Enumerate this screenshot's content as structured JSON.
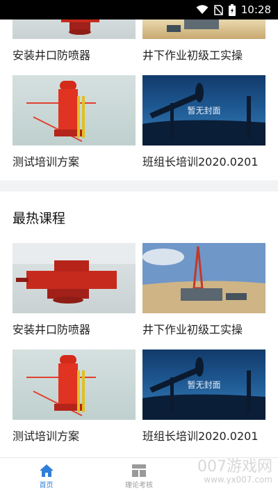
{
  "status": {
    "time": "10:28"
  },
  "top_section": {
    "courses": [
      {
        "title": "安装井口防喷器",
        "thumb": "bop"
      },
      {
        "title": "井下作业初级工实操",
        "thumb": "rig"
      },
      {
        "title": "测试培训方案",
        "thumb": "test"
      },
      {
        "title": "班组长培训2020.0201",
        "thumb": "pump",
        "placeholder": "暂无封面"
      }
    ]
  },
  "hot_section": {
    "title": "最热课程",
    "courses": [
      {
        "title": "安装井口防喷器",
        "thumb": "bop"
      },
      {
        "title": "井下作业初级工实操",
        "thumb": "rig"
      },
      {
        "title": "测试培训方案",
        "thumb": "test"
      },
      {
        "title": "班组长培训2020.0201",
        "thumb": "pump",
        "placeholder": "暂无封面"
      }
    ]
  },
  "tabbar": {
    "tabs": [
      {
        "label": "首页",
        "icon": "home-icon",
        "active": true
      },
      {
        "label": "理论考核",
        "icon": "exam-icon",
        "active": false
      }
    ]
  },
  "watermark": {
    "text": "007游戏网",
    "url": "www.yx007.com"
  },
  "colors": {
    "accent": "#2f7fd8"
  }
}
